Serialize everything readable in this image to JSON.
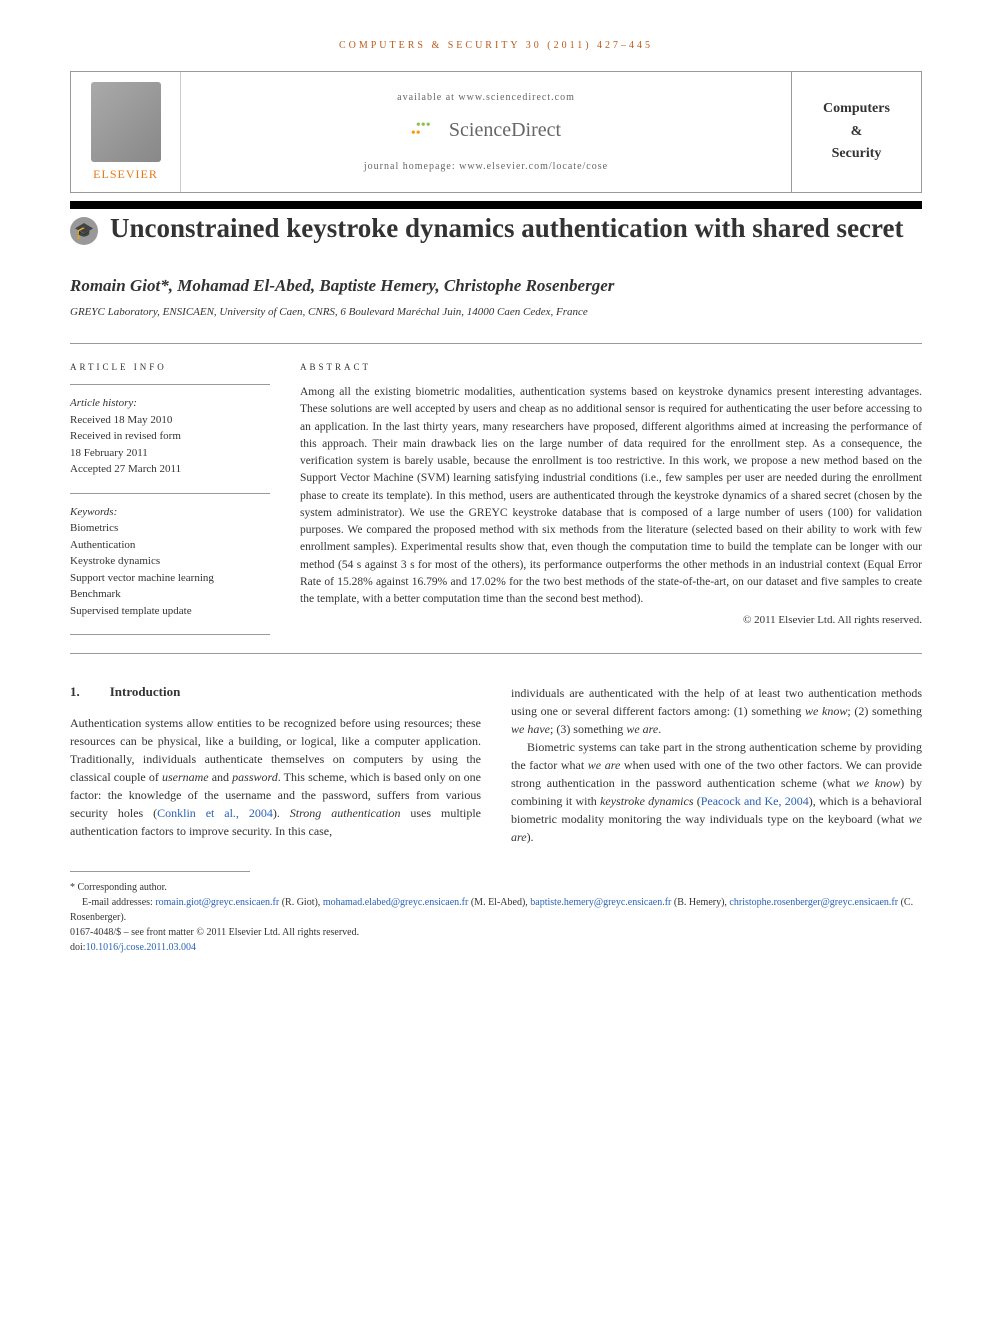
{
  "journal_header": "COMPUTERS & SECURITY 30 (2011) 427–445",
  "top": {
    "elsevier": "ELSEVIER",
    "available": "available at www.sciencedirect.com",
    "sciencedirect": "ScienceDirect",
    "homepage": "journal homepage: www.elsevier.com/locate/cose",
    "journal_name_l1": "Computers",
    "journal_name_l2": "&",
    "journal_name_l3": "Security"
  },
  "title": "Unconstrained keystroke dynamics authentication with shared secret",
  "authors": "Romain Giot*, Mohamad El-Abed, Baptiste Hemery, Christophe Rosenberger",
  "affiliation": "GREYC Laboratory, ENSICAEN, University of Caen, CNRS, 6 Boulevard Maréchal Juin, 14000 Caen Cedex, France",
  "info": {
    "heading": "ARTICLE INFO",
    "history_label": "Article history:",
    "received": "Received 18 May 2010",
    "revised_l1": "Received in revised form",
    "revised_l2": "18 February 2011",
    "accepted": "Accepted 27 March 2011",
    "keywords_label": "Keywords:",
    "keywords": [
      "Biometrics",
      "Authentication",
      "Keystroke dynamics",
      "Support vector machine learning",
      "Benchmark",
      "Supervised template update"
    ]
  },
  "abstract": {
    "heading": "ABSTRACT",
    "text": "Among all the existing biometric modalities, authentication systems based on keystroke dynamics present interesting advantages. These solutions are well accepted by users and cheap as no additional sensor is required for authenticating the user before accessing to an application. In the last thirty years, many researchers have proposed, different algorithms aimed at increasing the performance of this approach. Their main drawback lies on the large number of data required for the enrollment step. As a consequence, the verification system is barely usable, because the enrollment is too restrictive. In this work, we propose a new method based on the Support Vector Machine (SVM) learning satisfying industrial conditions (i.e., few samples per user are needed during the enrollment phase to create its template). In this method, users are authenticated through the keystroke dynamics of a shared secret (chosen by the system administrator). We use the GREYC keystroke database that is composed of a large number of users (100) for validation purposes. We compared the proposed method with six methods from the literature (selected based on their ability to work with few enrollment samples). Experimental results show that, even though the computation time to build the template can be longer with our method (54 s against 3 s for most of the others), its performance outperforms the other methods in an industrial context (Equal Error Rate of 15.28% against 16.79% and 17.02% for the two best methods of the state-of-the-art, on our dataset and five samples to create the template, with a better computation time than the second best method).",
    "copyright": "© 2011 Elsevier Ltd. All rights reserved."
  },
  "body": {
    "section_num": "1.",
    "section_title": "Introduction",
    "col1_p1a": "Authentication systems allow entities to be recognized before using resources; these resources can be physical, like a building, or logical, like a computer application. Traditionally, individuals authenticate themselves on computers by using the classical couple of ",
    "col1_italic1": "username",
    "col1_p1b": " and ",
    "col1_italic2": "password",
    "col1_p1c": ". This scheme, which is based only on one factor: the knowledge of the username and the password, suffers from various security holes (",
    "col1_link1": "Conklin et al., 2004",
    "col1_p1d": "). ",
    "col1_italic3": "Strong authentication",
    "col1_p1e": " uses multiple authentication factors to improve security. In this case,",
    "col2_p1a": "individuals are authenticated with the help of at least two authentication methods using one or several different factors among: (1) something ",
    "col2_i1": "we know",
    "col2_p1b": "; (2) something ",
    "col2_i2": "we have",
    "col2_p1c": "; (3) something ",
    "col2_i3": "we are",
    "col2_p1d": ".",
    "col2_p2a": "Biometric systems can take part in the strong authentication scheme by providing the factor what ",
    "col2_i4": "we are",
    "col2_p2b": " when used with one of the two other factors. We can provide strong authentication in the password authentication scheme (what ",
    "col2_i5": "we know",
    "col2_p2c": ") by combining it with ",
    "col2_i6": "keystroke dynamics",
    "col2_p2d": " (",
    "col2_link1": "Peacock and Ke, 2004",
    "col2_p2e": "), which is a behavioral biometric modality monitoring the way individuals type on the keyboard (what ",
    "col2_i7": "we are",
    "col2_p2f": ")."
  },
  "footer": {
    "corr": "* Corresponding author.",
    "emails_label": "E-mail addresses: ",
    "e1": "romain.giot@greyc.ensicaen.fr",
    "e1n": " (R. Giot), ",
    "e2": "mohamad.elabed@greyc.ensicaen.fr",
    "e2n": " (M. El-Abed), ",
    "e3": "baptiste.hemery@greyc.ensicaen.fr",
    "e3n": " (B. Hemery), ",
    "e4": "christophe.rosenberger@greyc.ensicaen.fr",
    "e4n": " (C. Rosenberger).",
    "issn": "0167-4048/$ – see front matter © 2011 Elsevier Ltd. All rights reserved.",
    "doi_label": "doi:",
    "doi": "10.1016/j.cose.2011.03.004"
  }
}
